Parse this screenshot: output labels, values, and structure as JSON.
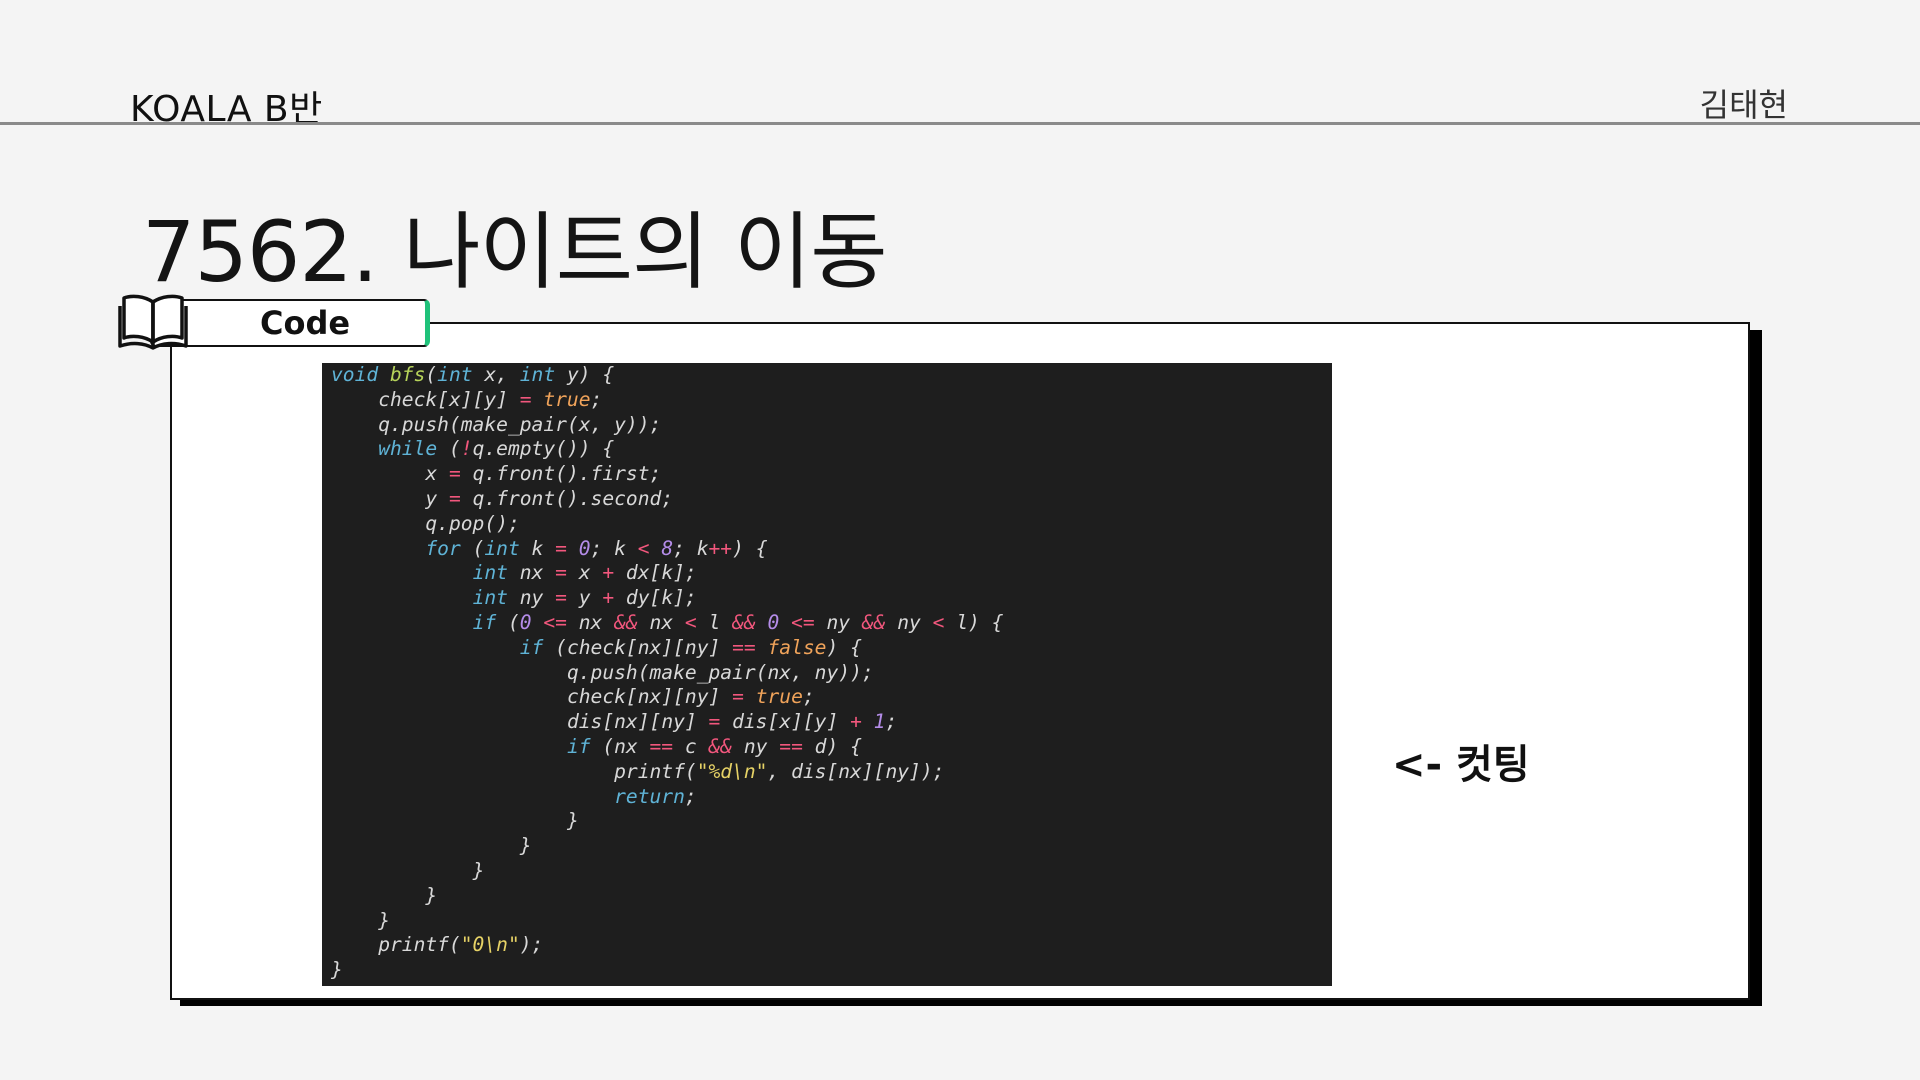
{
  "header": {
    "left": "KOALA B반",
    "right": "김태현"
  },
  "title": "7562. 나이트의 이동",
  "tab": {
    "label": "Code",
    "icon": "book-icon",
    "accent_color": "#1fc27a"
  },
  "code": {
    "language": "cpp",
    "lines": [
      "void bfs(int x, int y) {",
      "    check[x][y] = true;",
      "    q.push(make_pair(x, y));",
      "    while (!q.empty()) {",
      "        x = q.front().first;",
      "        y = q.front().second;",
      "        q.pop();",
      "        for (int k = 0; k < 8; k++) {",
      "            int nx = x + dx[k];",
      "            int ny = y + dy[k];",
      "            if (0 <= nx && nx < l && 0 <= ny && ny < l) {",
      "                if (check[nx][ny] == false) {",
      "                    q.push(make_pair(nx, ny));",
      "                    check[nx][ny] = true;",
      "                    dis[nx][ny] = dis[x][y] + 1;",
      "                    if (nx == c && ny == d) {",
      "                        printf(\"%d\\n\", dis[nx][ny]);",
      "                        return;",
      "                    }",
      "                }",
      "            }",
      "        }",
      "    }",
      "    printf(\"0\\n\");",
      "}"
    ],
    "colors": {
      "background": "#1e1e1e",
      "keyword": "#5fb3d6",
      "function": "#b6d35a",
      "literal": "#f0a35a",
      "number": "#b48ce8",
      "operator": "#f2577d",
      "string": "#e6d266",
      "text": "#d8d8d8"
    }
  },
  "annotation": "<- 컷팅"
}
